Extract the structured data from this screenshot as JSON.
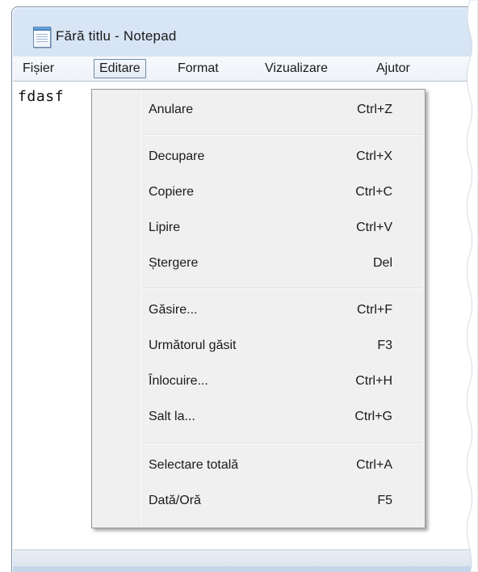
{
  "window": {
    "title": "Fără titlu - Notepad",
    "icon": "notepad-icon"
  },
  "menubar": {
    "items": [
      {
        "label": "Fișier"
      },
      {
        "label": "Editare"
      },
      {
        "label": "Format"
      },
      {
        "label": "Vizualizare"
      },
      {
        "label": "Ajutor"
      }
    ]
  },
  "editor": {
    "content": "fdasf"
  },
  "edit_menu": {
    "items": [
      {
        "label": "Anulare",
        "shortcut": "Ctrl+Z"
      },
      {
        "label": "Decupare",
        "shortcut": "Ctrl+X"
      },
      {
        "label": "Copiere",
        "shortcut": "Ctrl+C"
      },
      {
        "label": "Lipire",
        "shortcut": "Ctrl+V"
      },
      {
        "label": "Ștergere",
        "shortcut": "Del"
      },
      {
        "label": "Găsire...",
        "shortcut": "Ctrl+F"
      },
      {
        "label": "Următorul găsit",
        "shortcut": "F3"
      },
      {
        "label": "Înlocuire...",
        "shortcut": "Ctrl+H"
      },
      {
        "label": "Salt la...",
        "shortcut": "Ctrl+G"
      },
      {
        "label": "Selectare totală",
        "shortcut": "Ctrl+A"
      },
      {
        "label": "Dată/Oră",
        "shortcut": "F5"
      }
    ]
  },
  "colors": {
    "frame": "#c8d9ee",
    "menu_bg": "#f0f0f0",
    "menu_border": "#979797",
    "text": "#1a1a1a"
  }
}
